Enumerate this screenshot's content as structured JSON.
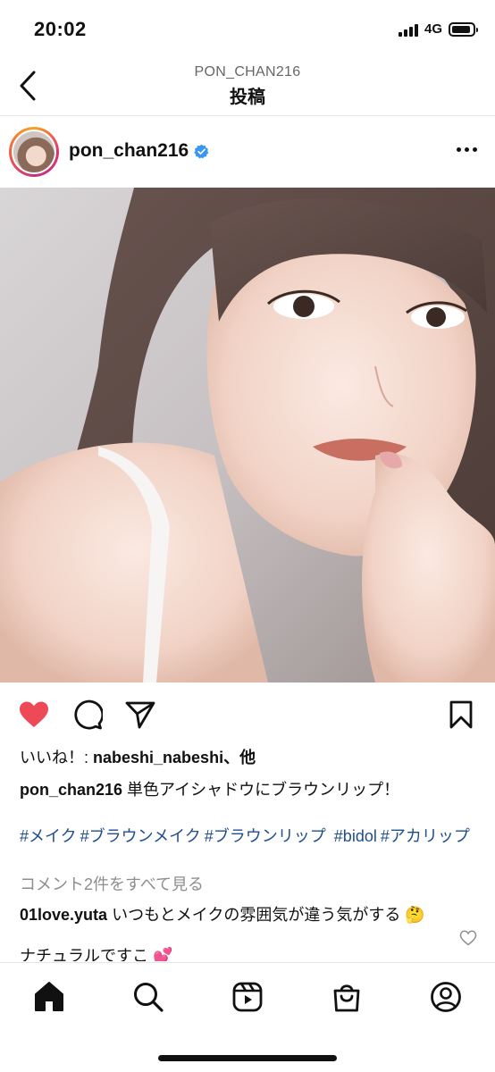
{
  "status_bar": {
    "time": "20:02",
    "network": "4G",
    "battery_level": 0.9
  },
  "nav": {
    "subtitle": "PON_CHAN216",
    "title": "投稿"
  },
  "post": {
    "username": "pon_chan216",
    "verified": true,
    "liked": true,
    "likes_prefix": "いいね！: ",
    "likes_user": "nabeshi_nabeshi",
    "likes_suffix": "、他",
    "caption_user": "pon_chan216",
    "caption_text": " 単色アイシャドウにブラウンリップ！",
    "hashtags": [
      "#メイク",
      "#ブラウンメイク",
      "#ブラウンリップ",
      " #bidol",
      "#アカリップ"
    ],
    "view_comments": "コメント2件をすべて見る",
    "comments": [
      {
        "user": "01love.yuta",
        "text": " いつもとメイクの雰囲気が違う気がする 🤔"
      },
      {
        "user": "",
        "text": "ナチュラルですこ 💕"
      }
    ]
  },
  "colors": {
    "like_red": "#ed4956",
    "hashtag_blue": "#1f4e8c",
    "verified_blue": "#3897f0",
    "muted_gray": "#8e8e8e"
  },
  "icons": {
    "back": "chevron-left-icon",
    "more": "more-horizontal-icon",
    "like": "heart-icon",
    "comment": "comment-icon",
    "share": "send-icon",
    "save": "bookmark-icon",
    "home": "home-icon",
    "search": "search-icon",
    "reels": "reels-icon",
    "shop": "shop-icon",
    "profile": "profile-icon"
  }
}
